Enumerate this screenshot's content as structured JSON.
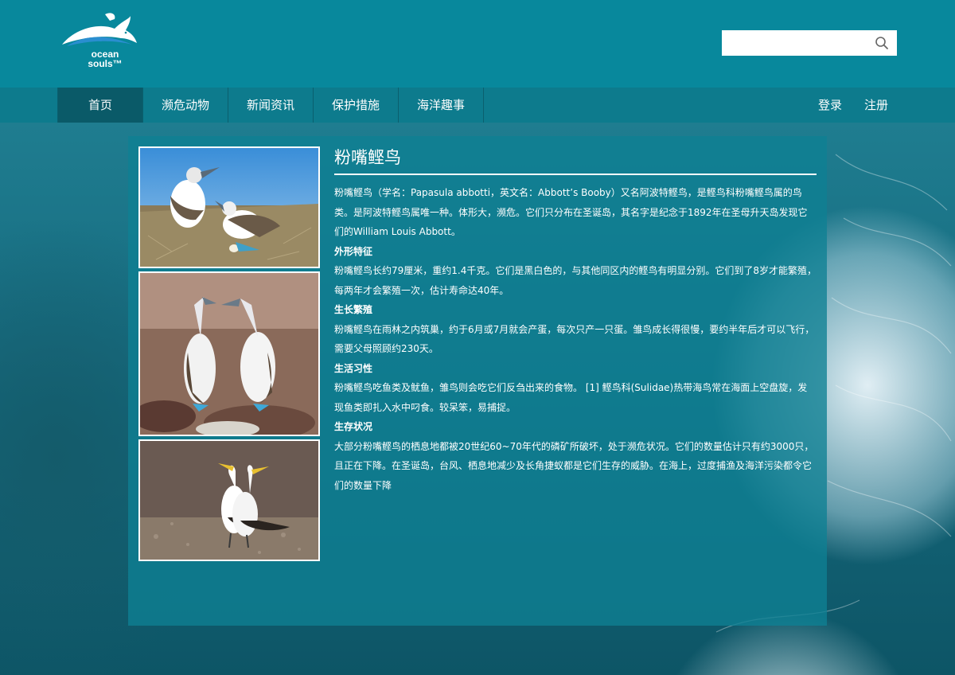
{
  "header": {
    "logo_text": [
      "ocean",
      "souls™"
    ],
    "search": {
      "value": "",
      "placeholder": ""
    }
  },
  "nav": {
    "items": [
      "首页",
      "濒危动物",
      "新闻资讯",
      "保护措施",
      "海洋趣事"
    ],
    "active": "首页",
    "login": "登录",
    "register": "注册"
  },
  "article": {
    "title": "粉嘴鲣鸟",
    "intro": "粉嘴鲣鸟（学名：Papasula abbotti，英文名：Abbott’s Booby）又名阿波特鲣鸟，是鲣鸟科粉嘴鲣鸟属的鸟类。是阿波特鲣鸟属唯一种。体形大，濒危。它们只分布在圣诞岛，其名字是纪念于1892年在圣母升天岛发现它们的William Louis Abbott。",
    "sections": [
      {
        "heading": "外形特征",
        "text": "粉嘴鲣鸟长约79厘米，重约1.4千克。它们是黑白色的，与其他同区内的鲣鸟有明显分别。它们到了8岁才能繁殖，每两年才会繁殖一次，估计寿命达40年。"
      },
      {
        "heading": "生长繁殖",
        "text": "粉嘴鲣鸟在雨林之内筑巢，约于6月或7月就会产蛋，每次只产一只蛋。雏鸟成长得很慢，要约半年后才可以飞行，需要父母照顾约230天。"
      },
      {
        "heading": "生活习性",
        "text": "粉嘴鲣鸟吃鱼类及鱿鱼，雏鸟则会吃它们反刍出来的食物。 [1] 鲣鸟科(Sulidae)热带海鸟常在海面上空盘旋，发现鱼类即扎入水中叼食。较呆笨，易捕捉。"
      },
      {
        "heading": "生存状况",
        "text": "大部分粉嘴鲣鸟的栖息地都被20世纪60~70年代的磷矿所破坏，处于濒危状况。它们的数量估计只有约3000只，且正在下降。在圣诞岛，台风、栖息地减少及长角捷蚁都是它们生存的威胁。在海上，过度捕渔及海洋污染都令它们的数量下降"
      }
    ]
  },
  "photos": [
    "booby-nest-photo",
    "booby-pair-rocks-photo",
    "booby-pair-ground-photo"
  ],
  "colors": {
    "header": "#08889c",
    "nav": "#0d7b8d",
    "nav_active": "#0a5a68",
    "panel": "#0e8094"
  }
}
